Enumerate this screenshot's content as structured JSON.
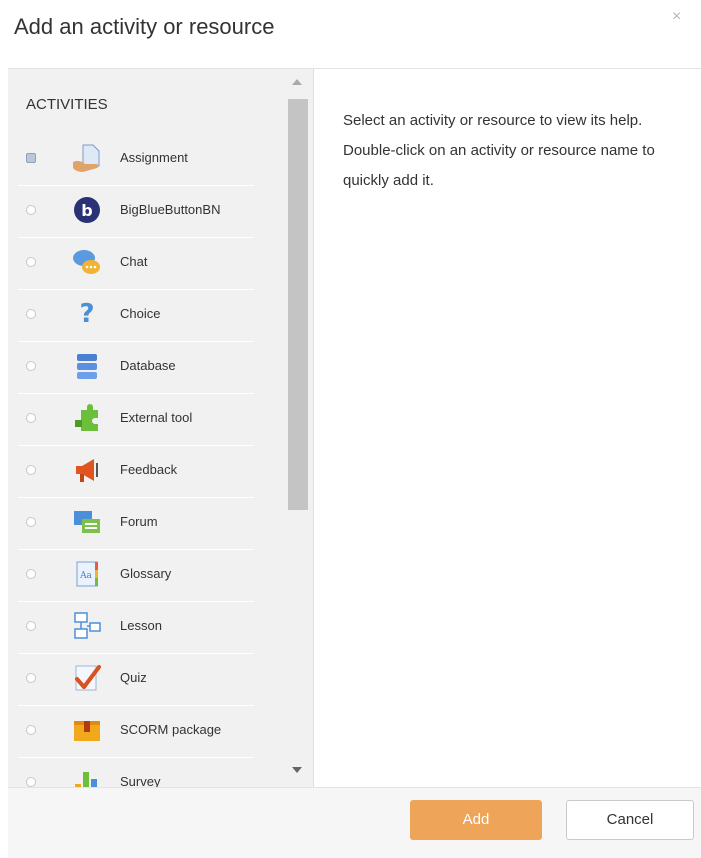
{
  "dialog": {
    "title": "Add an activity or resource",
    "close_glyph": "×"
  },
  "chooser": {
    "section_heading": "ACTIVITIES",
    "selected_index": 0,
    "items": [
      {
        "label": "Assignment",
        "icon": "assignment-icon"
      },
      {
        "label": "BigBlueButtonBN",
        "icon": "bigbluebutton-icon"
      },
      {
        "label": "Chat",
        "icon": "chat-icon"
      },
      {
        "label": "Choice",
        "icon": "choice-icon"
      },
      {
        "label": "Database",
        "icon": "database-icon"
      },
      {
        "label": "External tool",
        "icon": "external-tool-icon"
      },
      {
        "label": "Feedback",
        "icon": "feedback-icon"
      },
      {
        "label": "Forum",
        "icon": "forum-icon"
      },
      {
        "label": "Glossary",
        "icon": "glossary-icon"
      },
      {
        "label": "Lesson",
        "icon": "lesson-icon"
      },
      {
        "label": "Quiz",
        "icon": "quiz-icon"
      },
      {
        "label": "SCORM package",
        "icon": "scorm-package-icon"
      },
      {
        "label": "Survey",
        "icon": "survey-icon"
      }
    ]
  },
  "help": {
    "text": "Select an activity or resource to view its help. Double-click on an activity or resource name to quickly add it."
  },
  "footer": {
    "add_label": "Add",
    "cancel_label": "Cancel"
  },
  "colors": {
    "add_button": "#eea55a",
    "left_panel": "#f1f1f1"
  }
}
